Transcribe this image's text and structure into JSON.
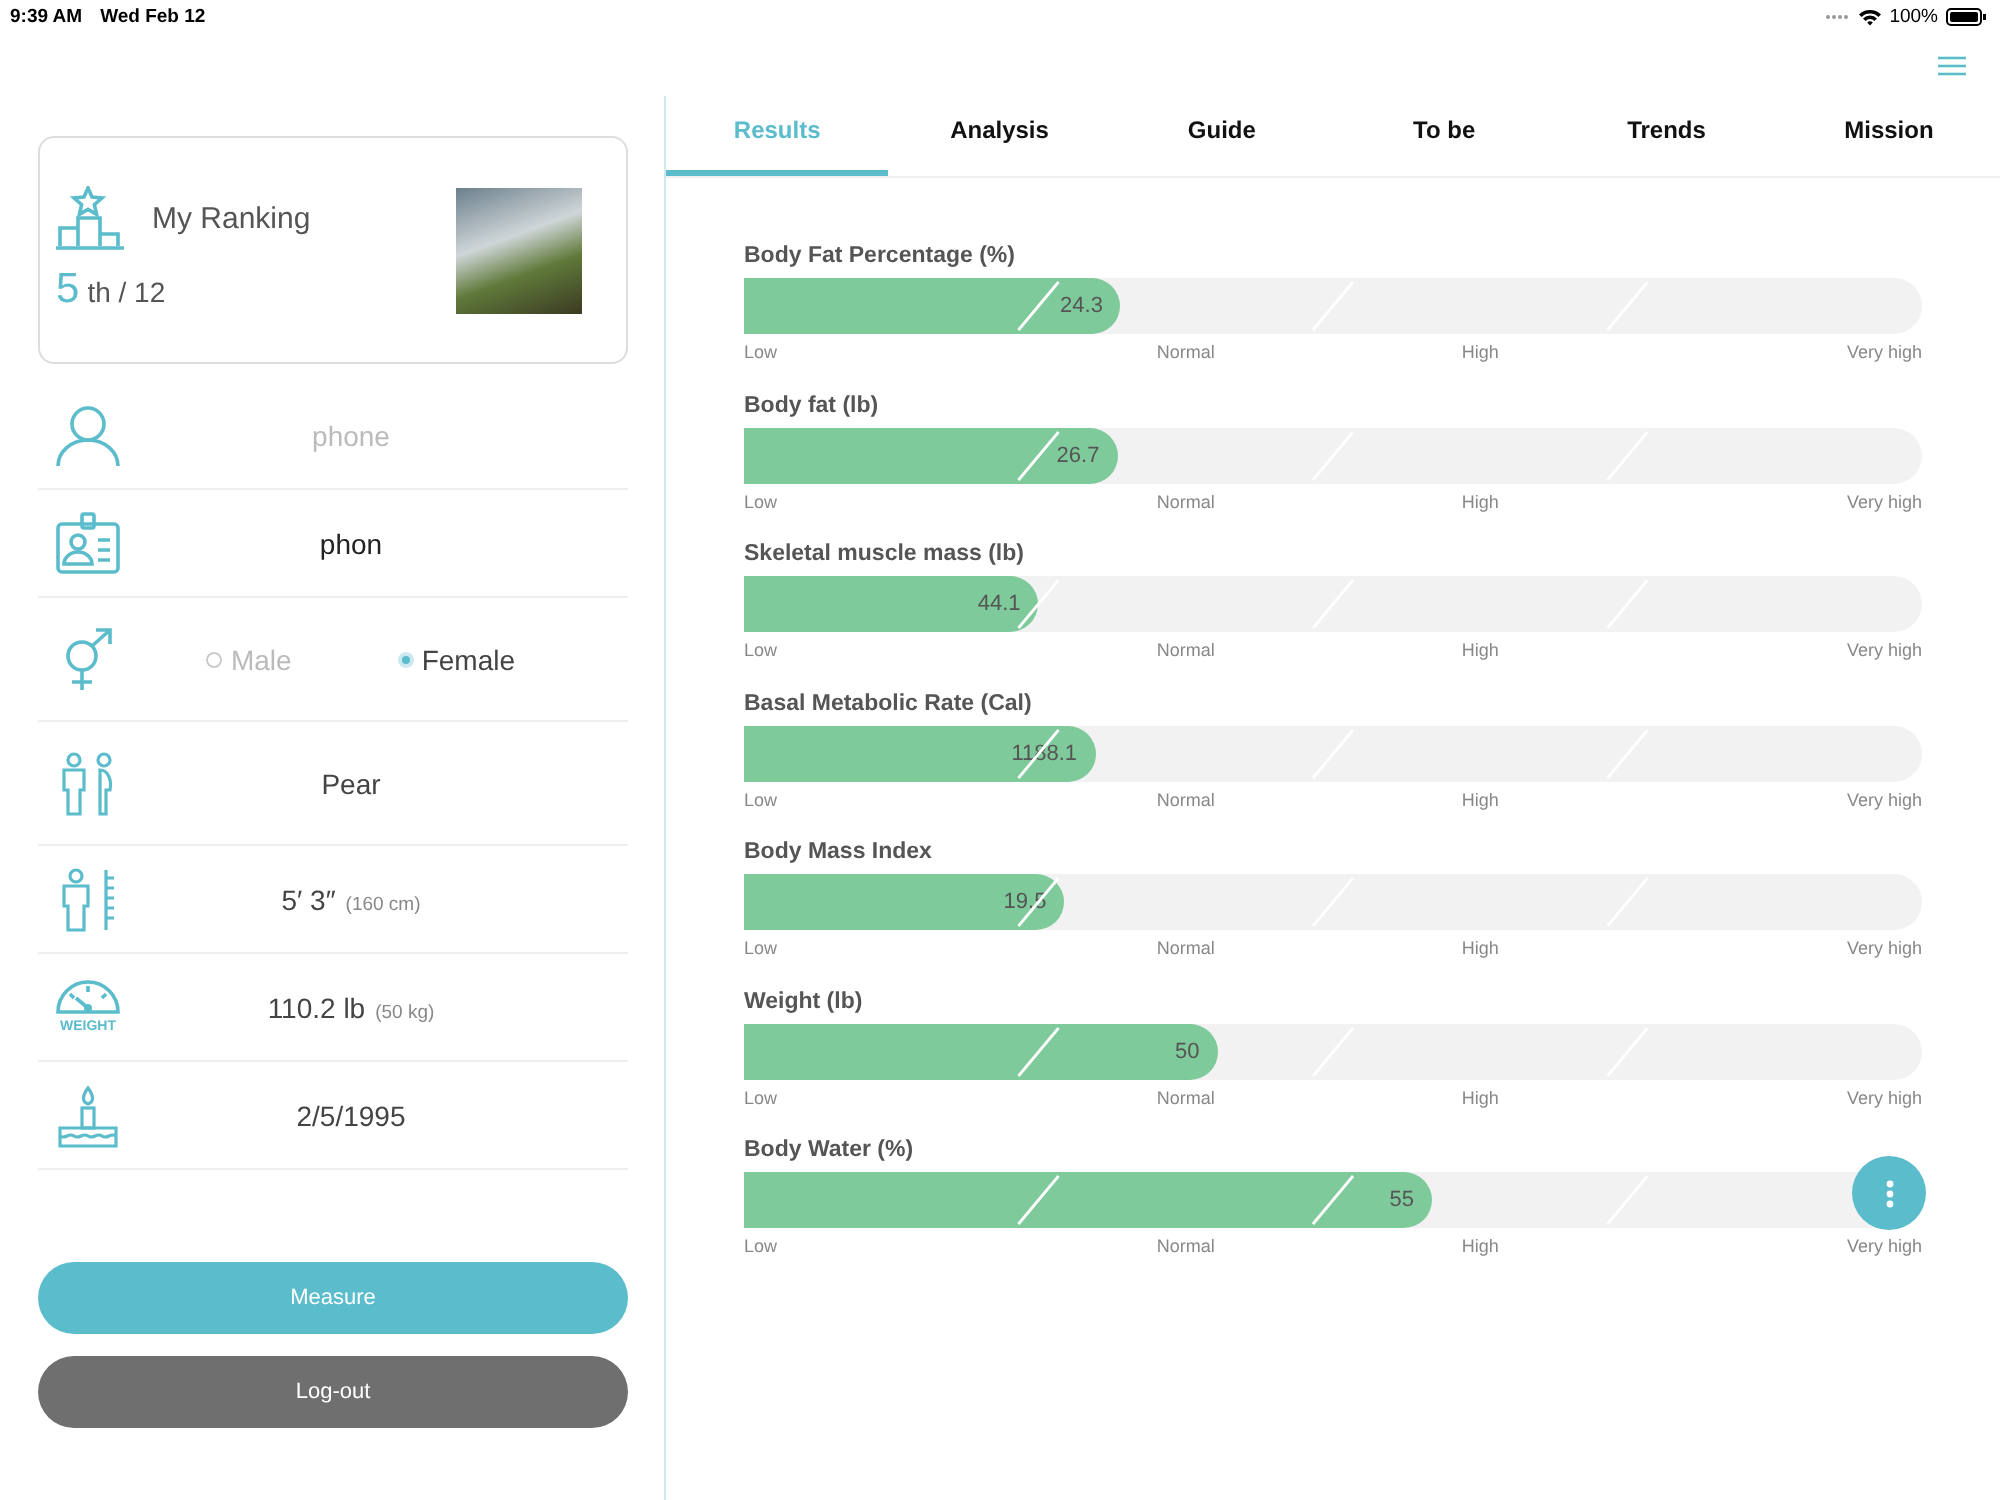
{
  "status_bar": {
    "time": "9:39 AM",
    "date": "Wed Feb 12",
    "battery": "100%"
  },
  "ranking": {
    "title": "My Ranking",
    "rank": "5",
    "suffix": "th / 12"
  },
  "profile": [
    {
      "kind": "name",
      "placeholder": "phone"
    },
    {
      "kind": "id",
      "value": "phon"
    },
    {
      "kind": "gender",
      "options": [
        {
          "label": "Male",
          "selected": false
        },
        {
          "label": "Female",
          "selected": true
        }
      ]
    },
    {
      "kind": "body_type",
      "value": "Pear"
    },
    {
      "kind": "height",
      "value": "5′ 3″",
      "sub": "(160 cm)"
    },
    {
      "kind": "weight",
      "caption": "WEIGHT",
      "value": "110.2 lb",
      "sub": "(50 kg)"
    },
    {
      "kind": "birthdate",
      "value": "2/5/1995"
    }
  ],
  "buttons": [
    {
      "kind": "primary",
      "label": "Measure"
    },
    {
      "kind": "secondary",
      "label": "Log-out"
    }
  ],
  "tabs": [
    {
      "label": "Results",
      "selected": true
    },
    {
      "label": "Analysis",
      "selected": false
    },
    {
      "label": "Guide",
      "selected": false
    },
    {
      "label": "To be",
      "selected": false
    },
    {
      "label": "Trends",
      "selected": false
    },
    {
      "label": "Mission",
      "selected": false
    }
  ],
  "metrics": [
    {
      "title": "Body Fat Percentage (%)",
      "value": "24.3",
      "level": 0.32,
      "scale": [
        "Low",
        "Normal",
        "High",
        "Very high"
      ]
    },
    {
      "title": "Body fat (lb)",
      "value": "26.7",
      "level": 0.317,
      "scale": [
        "Low",
        "Normal",
        "High",
        "Very high"
      ]
    },
    {
      "title": "Skeletal muscle mass (lb)",
      "value": "44.1",
      "level": 0.25,
      "scale": [
        "Low",
        "Normal",
        "High",
        "Very high"
      ]
    },
    {
      "title": "Basal Metabolic Rate (Cal)",
      "value": "1188.1",
      "level": 0.298,
      "scale": [
        "Low",
        "Normal",
        "High",
        "Very high"
      ]
    },
    {
      "title": "Body Mass Index",
      "value": "19.5",
      "level": 0.272,
      "scale": [
        "Low",
        "Normal",
        "High",
        "Very high"
      ]
    },
    {
      "title": "Weight (lb)",
      "value": "50",
      "level": 0.402,
      "scale": [
        "Low",
        "Normal",
        "High",
        "Very high"
      ]
    },
    {
      "title": "Body Water (%)",
      "value": "55",
      "level": 0.584,
      "scale": [
        "Low",
        "Normal",
        "High",
        "Very high"
      ]
    }
  ]
}
